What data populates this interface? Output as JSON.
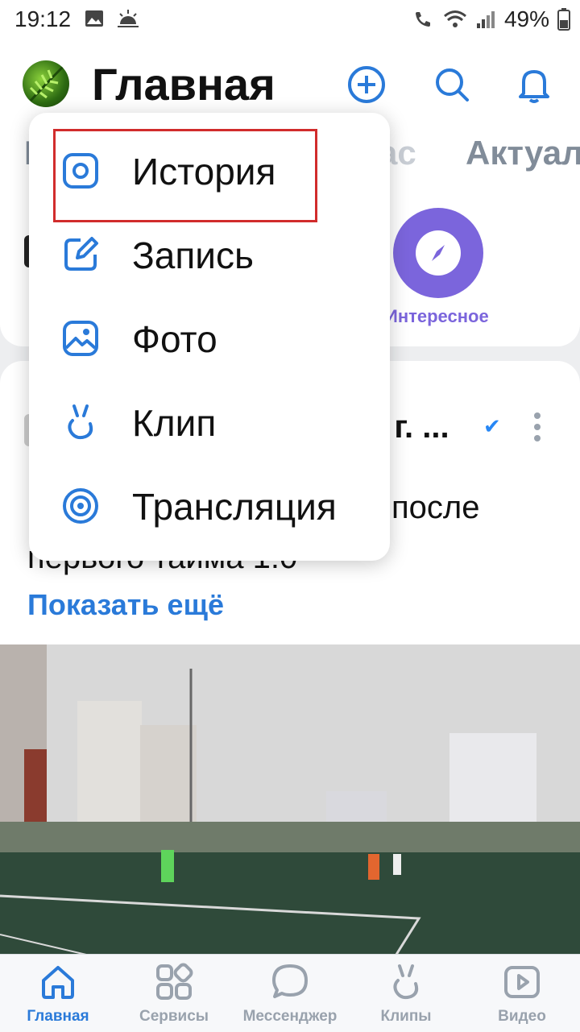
{
  "status_bar": {
    "time": "19:12",
    "battery": "49%"
  },
  "header": {
    "title": "Главная"
  },
  "tabs": [
    {
      "label": "Г"
    },
    {
      "label": "ас"
    },
    {
      "label": "Актуал"
    }
  ],
  "stories": {
    "label": "Интересное"
  },
  "post": {
    "author_fragment": "» г. ...",
    "text_line_1": "после",
    "text_line_2": "первого тайма 1:0",
    "show_more": "Показать ещё"
  },
  "menu": {
    "items": [
      {
        "label": "История",
        "icon": "story-icon"
      },
      {
        "label": "Запись",
        "icon": "edit-icon"
      },
      {
        "label": "Фото",
        "icon": "photo-icon"
      },
      {
        "label": "Клип",
        "icon": "clip-icon"
      },
      {
        "label": "Трансляция",
        "icon": "broadcast-icon"
      }
    ]
  },
  "bottom_nav": [
    {
      "label": "Главная",
      "icon": "home-icon",
      "active": true
    },
    {
      "label": "Сервисы",
      "icon": "services-icon"
    },
    {
      "label": "Мессенджер",
      "icon": "messenger-icon"
    },
    {
      "label": "Клипы",
      "icon": "clips-icon"
    },
    {
      "label": "Видео",
      "icon": "video-icon"
    }
  ],
  "colors": {
    "accent": "#2a7ad9",
    "highlight": "#d12c2c",
    "interesting": "#7b65dc"
  }
}
